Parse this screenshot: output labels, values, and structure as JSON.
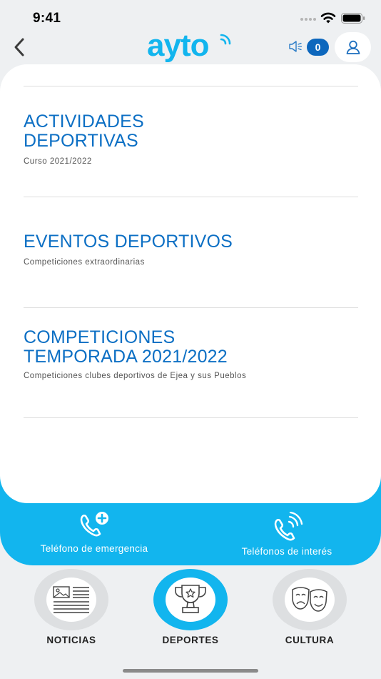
{
  "status_bar": {
    "time": "9:41"
  },
  "header": {
    "logo_text": "ayto",
    "notification_count": "0",
    "icons": {
      "back": "chevron-left-icon",
      "speaker": "speaker-icon",
      "user": "user-icon"
    }
  },
  "sections": [
    {
      "title_line1": "ACTIVIDADES",
      "title_line2": "DEPORTIVAS",
      "subtitle": "Curso 2021/2022"
    },
    {
      "title_line1": "EVENTOS DEPORTIVOS",
      "subtitle": "Competiciones extraordinarias"
    },
    {
      "title_line1": "COMPETICIONES",
      "title_line2": "TEMPORADA 2021/2022",
      "subtitle": "Competiciones clubes deportivos de Ejea y sus Pueblos"
    }
  ],
  "phones": {
    "emergency_label": "Teléfono de emergencia",
    "interest_label": "Teléfonos de interés"
  },
  "tabs": [
    {
      "label": "NOTICIAS",
      "icon": "newspaper-icon",
      "active": false
    },
    {
      "label": "DEPORTES",
      "icon": "trophy-icon",
      "active": true
    },
    {
      "label": "CULTURA",
      "icon": "theater-masks-icon",
      "active": false
    }
  ],
  "colors": {
    "brand_blue": "#12b5ee",
    "title_blue": "#0c6fc4",
    "badge_blue": "#0d67bd"
  }
}
